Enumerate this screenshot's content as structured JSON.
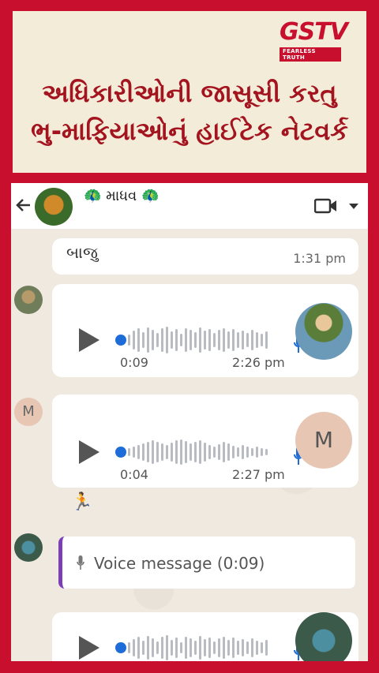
{
  "brand": {
    "logo_text_gs": "GS",
    "logo_text_tv": "TV",
    "logo_tagline": "FEARLESS TRUTH"
  },
  "headline": {
    "line1": "અધિકારીઓની જાસૂસી કરતુ",
    "line2": "ભુ-માફિયાઓનું હાઈટેક નેટવર્ક"
  },
  "chat": {
    "contact_name": "🦚 માધવ 🦚",
    "messages": [
      {
        "type": "text",
        "text": "બાજુ",
        "time": "1:31 pm"
      },
      {
        "type": "voice",
        "duration": "0:09",
        "time": "2:26 pm"
      },
      {
        "type": "voice",
        "duration": "0:04",
        "time": "2:27 pm",
        "avatar_letter": "M"
      },
      {
        "type": "reply",
        "text": "Voice message (0:09)"
      }
    ],
    "small_avatar_letter": "M",
    "emoji_sticker": "🏃"
  },
  "colors": {
    "brand_red": "#c8102e",
    "headline_text": "#a3141f",
    "headline_bg": "#f3ecd9",
    "play_dot": "#1e6cd8",
    "mic": "#1e6cd8",
    "reply_bar": "#7b3fb5"
  }
}
